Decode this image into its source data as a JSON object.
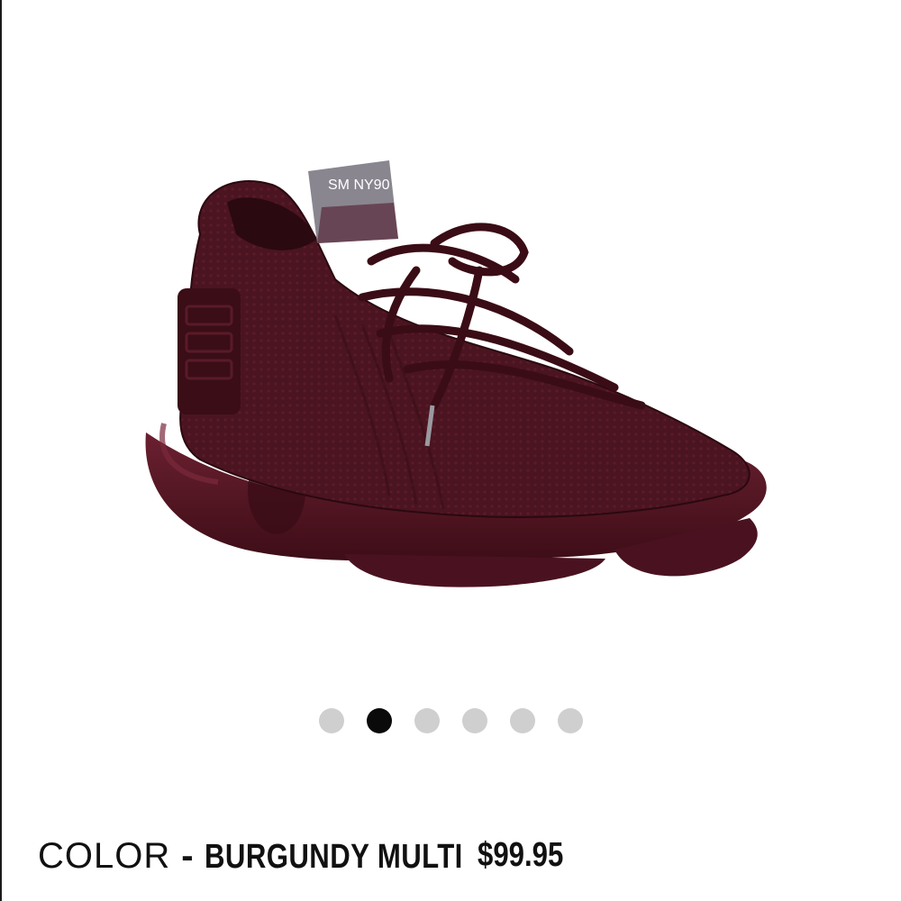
{
  "product": {
    "image_alt": "Burgundy knit lace-up sneaker with chunky sole",
    "heel_tab_text": "SM NY90",
    "colors": {
      "shoe_main": "#4a1420",
      "shoe_dark": "#2e0a12",
      "shoe_light": "#6a2232",
      "sole": "#571826"
    }
  },
  "carousel": {
    "count": 6,
    "active_index": 1,
    "active_color": "#0a0a0a",
    "inactive_color": "#cfcfcf"
  },
  "details": {
    "color_label": "COLOR",
    "separator": "-",
    "color_value": "BURGUNDY MULTI",
    "price": "$99.95"
  }
}
